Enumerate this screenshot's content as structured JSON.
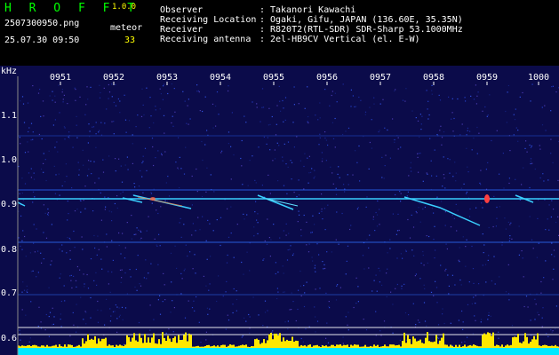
{
  "app": {
    "logo": "H R O F F T",
    "version": "1.0.0",
    "filename": "2507300950.png",
    "datetime": "25.07.30 09:50",
    "meteor_label": "meteor",
    "meteor_count": "33"
  },
  "info": {
    "labels": [
      "Observer",
      "Receiving Location",
      "Receiver",
      "Receiving antenna"
    ],
    "colons": [
      ":",
      ":",
      ":",
      ":"
    ],
    "values": [
      "Takanori Kawachi",
      "Ogaki, Gifu, JAPAN (136.60E, 35.35N)",
      "R820T2(RTL-SDR) SDR-Sharp 53.1000MHz",
      "2el-HB9CV Vertical (el. E-W)"
    ]
  },
  "axis": {
    "unit": "kHz",
    "time_ticks": [
      "0951",
      "0952",
      "0953",
      "0954",
      "0955",
      "0956",
      "0957",
      "0958",
      "0959",
      "1000"
    ],
    "freq_ticks": [
      "1.1",
      "1.0",
      "0.9",
      "0.8",
      "0.7",
      "0.6"
    ]
  },
  "colors": {
    "background": "#000000",
    "spectrogram_bg": "#0b0b4a",
    "carrier": "#3ad0ff",
    "meteor_head": "#ff4040",
    "activity_bar": "#ffe800",
    "baseline": "#00e8ff",
    "logo": "#00ff00",
    "header_value": "#ffff00"
  }
}
